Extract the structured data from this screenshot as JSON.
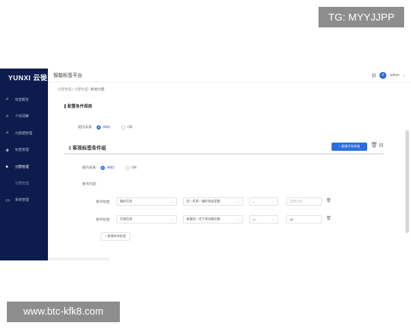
{
  "watermarks": {
    "top": "TG: MYYJJPP",
    "bottom": "www.btc-kfk8.com"
  },
  "sidebar": {
    "logo": "YUNXI 云徙",
    "items": [
      {
        "label": "标签概览",
        "icon": "chart-icon"
      },
      {
        "label": "个体洞察",
        "icon": "people-icon"
      },
      {
        "label": "元数据管理",
        "icon": "database-icon"
      },
      {
        "label": "标签管理",
        "icon": "tag-icon"
      },
      {
        "label": "分群管理",
        "icon": "group-icon",
        "active": true
      },
      {
        "label": "分群管理",
        "sub": true
      },
      {
        "label": "系统管理",
        "icon": "monitor-icon"
      }
    ]
  },
  "header": {
    "title": "智能标签平台",
    "user": "admin",
    "user_initial": "A"
  },
  "breadcrumb": [
    "分群管理",
    "分群管理",
    "新增分群"
  ],
  "form": {
    "section_title": "配置条件规则",
    "top_relation": {
      "label": "组内关系:",
      "options": [
        "AND",
        "OR"
      ],
      "selected": "AND"
    },
    "group": {
      "title": "1 客观标签条件组",
      "add_sub_group_label": "+ 新增子条件组",
      "relation": {
        "label": "组内关系:",
        "options": [
          "AND",
          "OR"
        ],
        "selected": "AND"
      },
      "content_label": "条件内容:",
      "rows": [
        {
          "label": "条件标签:",
          "field1": "偏好信息",
          "field2": "近一年第一偏好商品定额",
          "op": "=",
          "value": "自然价值",
          "value_placeholder": true
        },
        {
          "label": "条件标签:",
          "field1": "交易信息",
          "field2": "离最近一次下单间隔天数",
          "op": ">=",
          "value": "30",
          "value_placeholder": false
        }
      ],
      "add_condition_label": "+ 新增条件标签"
    }
  },
  "colors": {
    "sidebar_bg": "#0e1b4d",
    "accent": "#2b6de0"
  }
}
